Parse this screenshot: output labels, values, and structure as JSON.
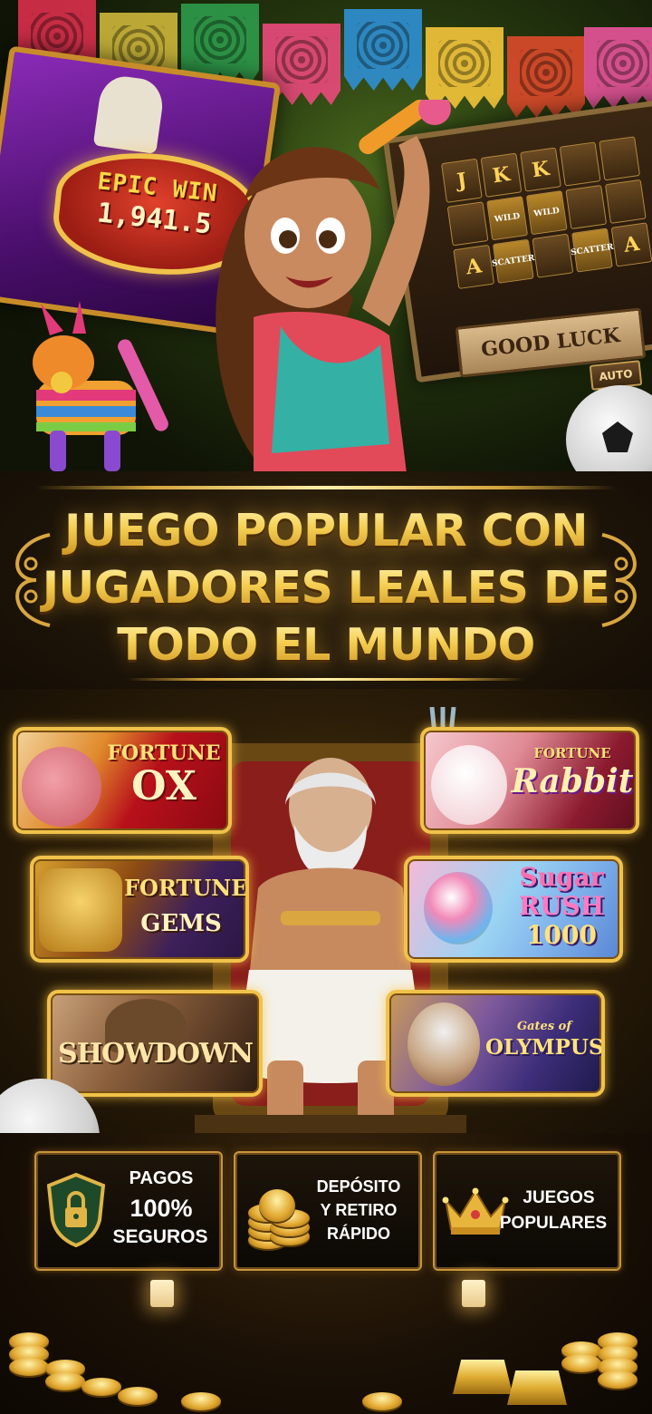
{
  "hero": {
    "epic_win_title": "EPIC WIN",
    "epic_win_amount": "1,941.5",
    "good_luck_sign": "GOOD LUCK",
    "auto_button": "AUTO",
    "reel_symbols": [
      "J",
      "K",
      "K",
      "",
      "",
      "",
      "WILD",
      "WILD",
      "",
      "",
      "A",
      "SCATTER",
      "",
      "SCATTER",
      "A"
    ]
  },
  "headline": {
    "lines": [
      "JUEGO POPULAR CON",
      "JUGADORES LEALES DE",
      "TODO EL MUNDO"
    ]
  },
  "games": [
    {
      "id": "fortune-ox",
      "line1": "FORTUNE",
      "line2": "OX"
    },
    {
      "id": "fortune-rabbit",
      "line1": "FORTUNE",
      "line2": "Rabbit"
    },
    {
      "id": "fortune-gems",
      "line1": "FORTUNE",
      "line2": "GEMS"
    },
    {
      "id": "sugar-rush",
      "line1": "Sugar",
      "line2": "RUSH",
      "line3": "1000"
    },
    {
      "id": "showdown",
      "line1": "SHOWDOWN"
    },
    {
      "id": "olympus",
      "line1": "Gates of",
      "line2": "OLYMPUS"
    }
  ],
  "features": [
    {
      "line1": "PAGOS",
      "line2": "100%",
      "line3": "SEGUROS",
      "icon": "shield-lock-icon"
    },
    {
      "line1": "DEPÓSITO",
      "line2": "Y RETIRO",
      "line3": "RÁPIDO",
      "icon": "coin-stack-icon"
    },
    {
      "line1": "JUEGOS",
      "line2": "POPULARES",
      "icon": "crown-icon"
    }
  ],
  "colors": {
    "gold": "#f5cf52",
    "dark_bg": "#140d05",
    "frame": "#f0c24a"
  }
}
